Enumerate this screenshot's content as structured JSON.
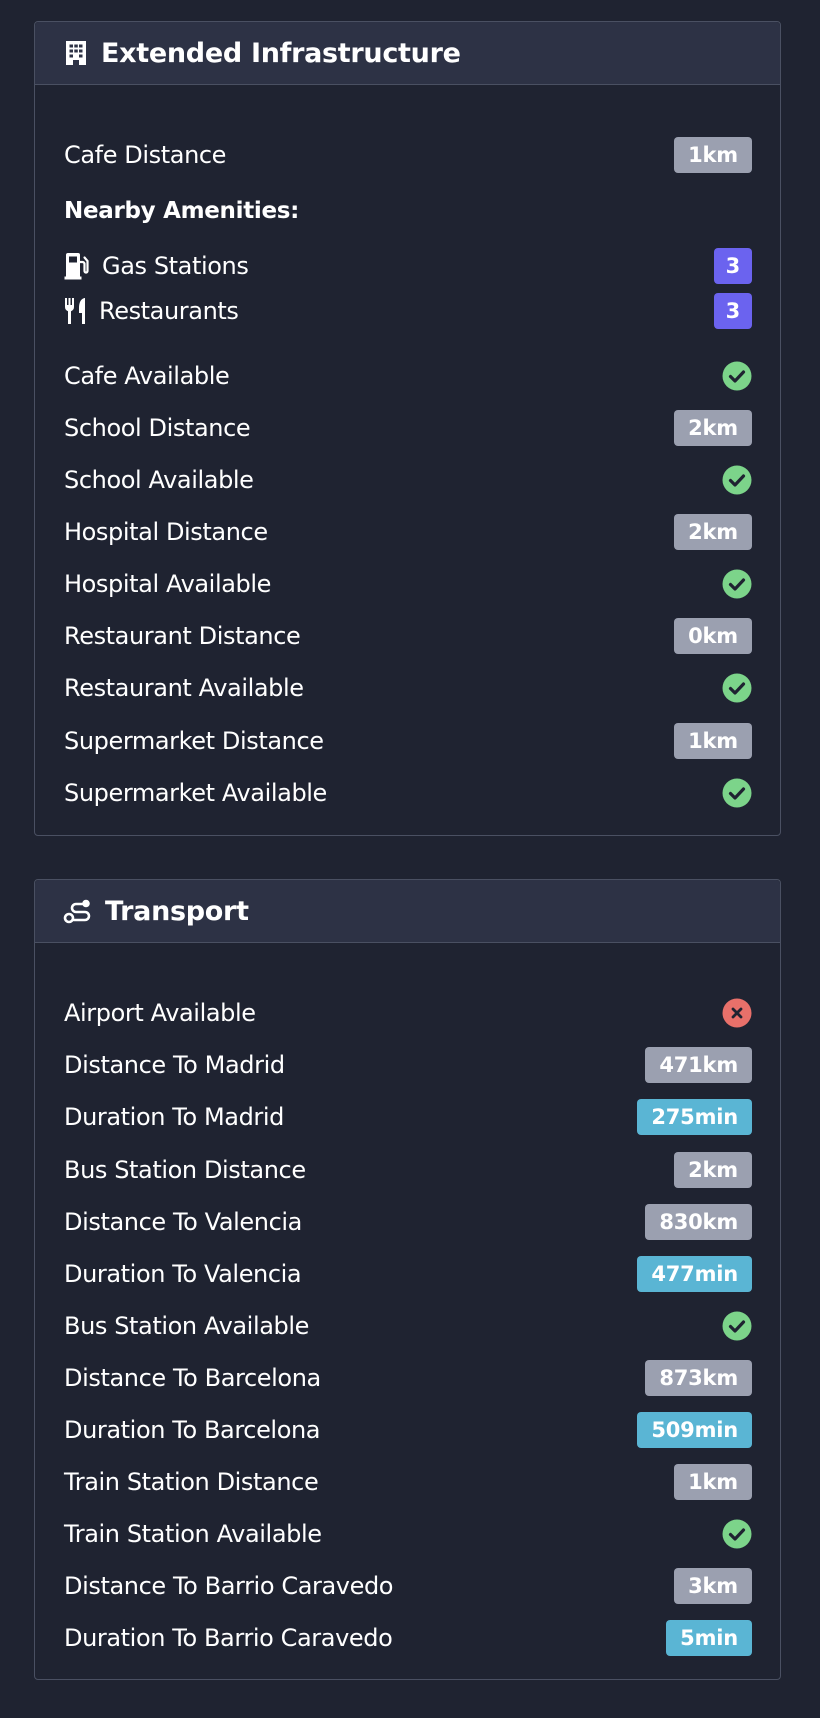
{
  "infrastructure": {
    "title": "Extended Infrastructure",
    "icon": "building-icon",
    "cafe_distance": {
      "label": "Cafe Distance",
      "value": "1km"
    },
    "amenities_heading": "Nearby Amenities:",
    "amenities": [
      {
        "icon": "gas-pump-icon",
        "label": "Gas Stations",
        "count": "3"
      },
      {
        "icon": "utensils-icon",
        "label": "Restaurants",
        "count": "3"
      }
    ],
    "rows": [
      {
        "label": "Cafe Available",
        "status": "yes"
      },
      {
        "label": "School Distance",
        "value": "2km"
      },
      {
        "label": "School Available",
        "status": "yes"
      },
      {
        "label": "Hospital Distance",
        "value": "2km"
      },
      {
        "label": "Hospital Available",
        "status": "yes"
      },
      {
        "label": "Restaurant Distance",
        "value": "0km"
      },
      {
        "label": "Restaurant Available",
        "status": "yes"
      },
      {
        "label": "Supermarket Distance",
        "value": "1km"
      },
      {
        "label": "Supermarket Available",
        "status": "yes"
      }
    ]
  },
  "transport": {
    "title": "Transport",
    "icon": "route-icon",
    "rows": [
      {
        "label": "Airport Available",
        "status": "no"
      },
      {
        "label": "Distance To Madrid",
        "value": "471km"
      },
      {
        "label": "Duration To Madrid",
        "value": "275min",
        "kind": "duration"
      },
      {
        "label": "Bus Station Distance",
        "value": "2km"
      },
      {
        "label": "Distance To Valencia",
        "value": "830km"
      },
      {
        "label": "Duration To Valencia",
        "value": "477min",
        "kind": "duration"
      },
      {
        "label": "Bus Station Available",
        "status": "yes"
      },
      {
        "label": "Distance To Barcelona",
        "value": "873km"
      },
      {
        "label": "Duration To Barcelona",
        "value": "509min",
        "kind": "duration"
      },
      {
        "label": "Train Station Distance",
        "value": "1km"
      },
      {
        "label": "Train Station Available",
        "status": "yes"
      },
      {
        "label": "Distance To Barrio Caravedo",
        "value": "3km"
      },
      {
        "label": "Duration To Barrio Caravedo",
        "value": "5min",
        "kind": "duration"
      }
    ]
  },
  "colors": {
    "background": "#1f2331",
    "header": "#2d3245",
    "badge_distance": "#9ba0b0",
    "badge_duration": "#5ab5d4",
    "badge_count": "#6b63ef",
    "status_yes": "#7cd48a",
    "status_no": "#e8706a"
  }
}
